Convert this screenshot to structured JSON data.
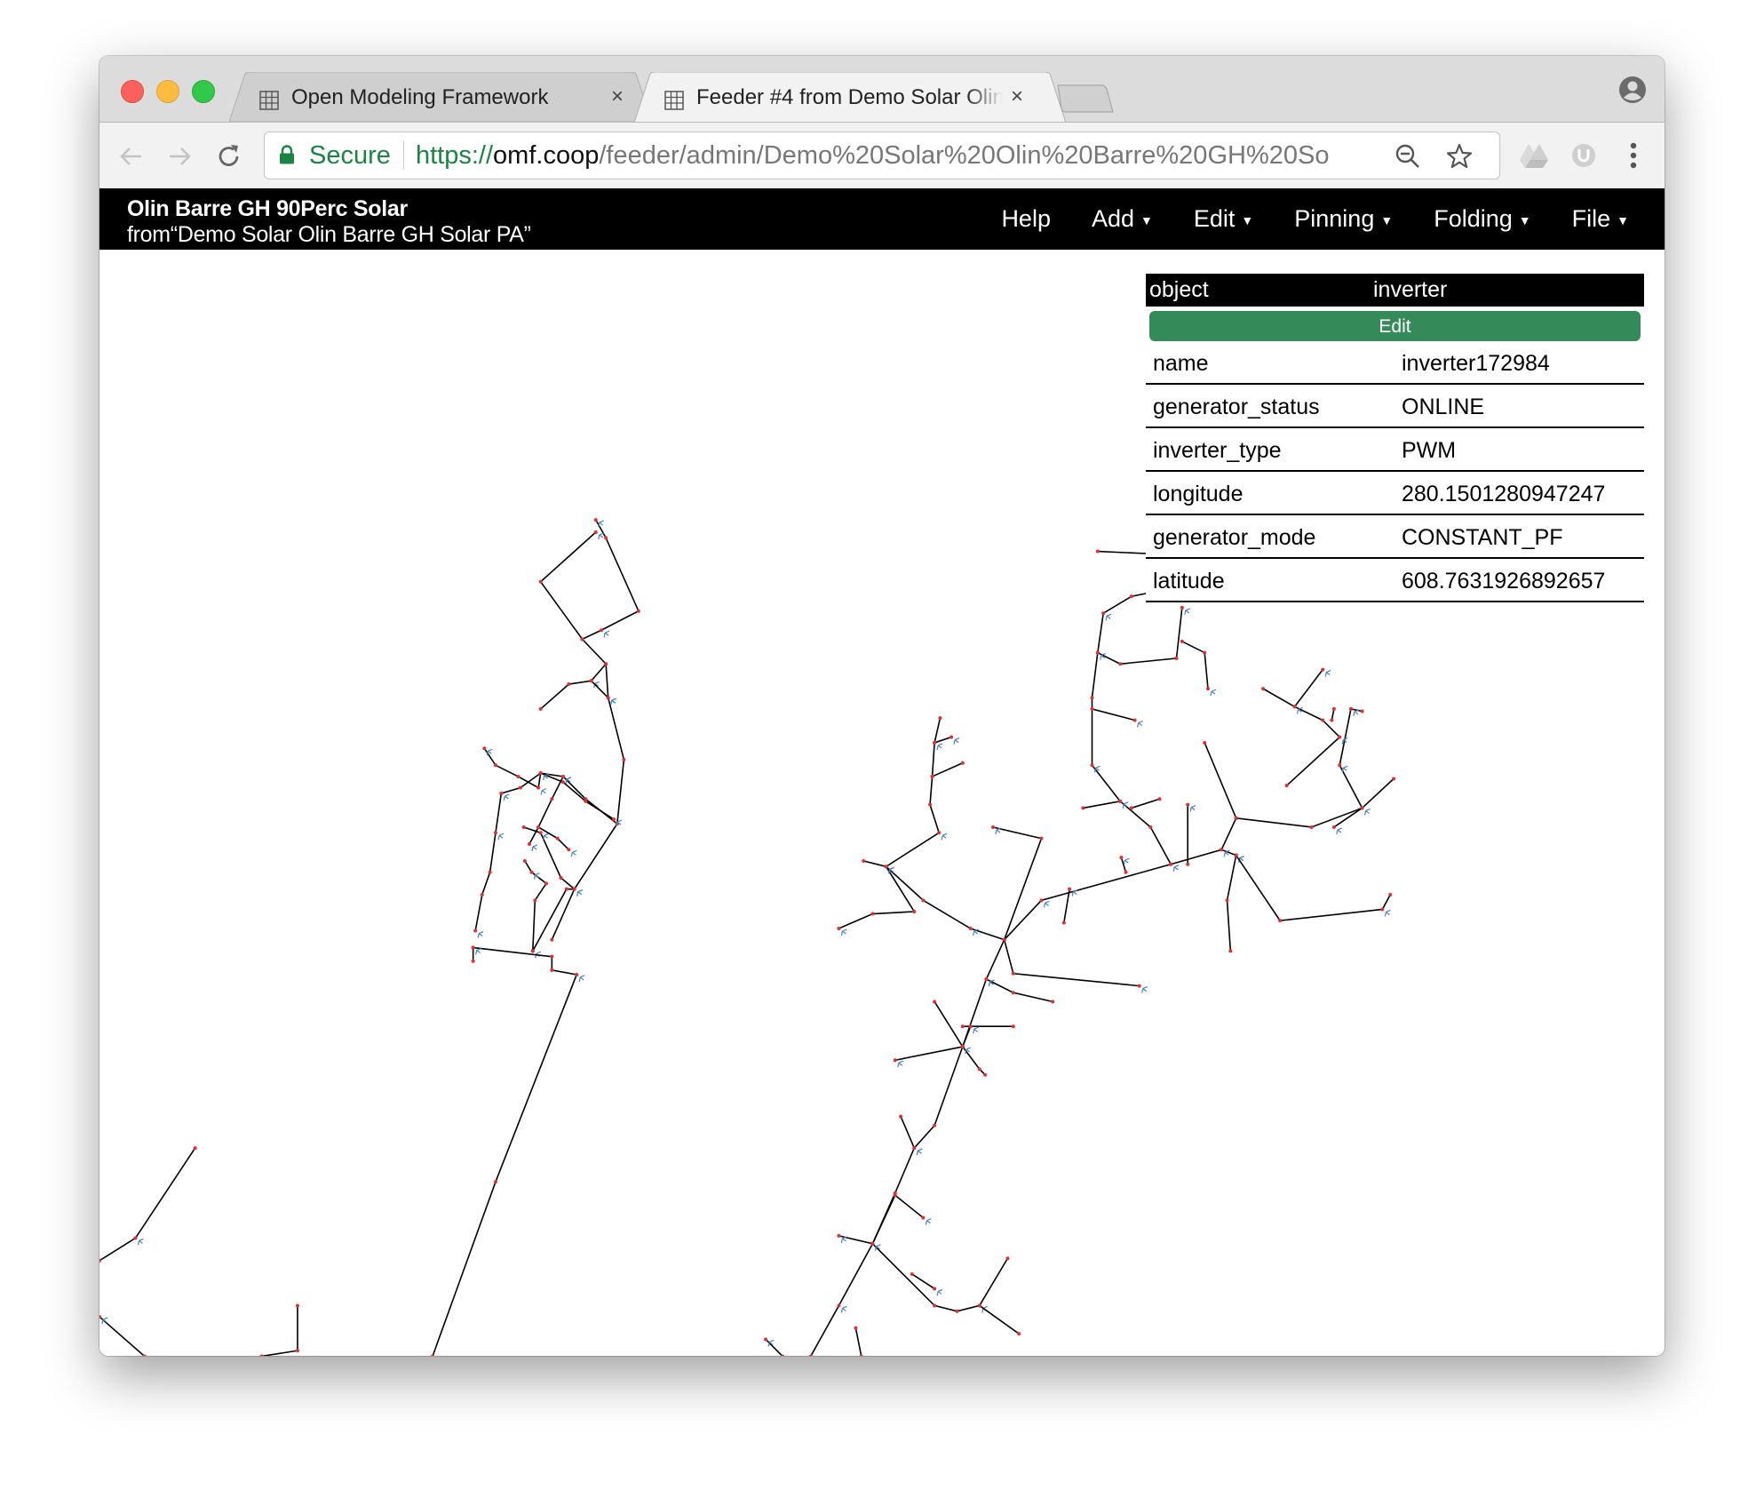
{
  "browser": {
    "tabs": [
      {
        "title": "Open Modeling Framework",
        "icon": "grid-page-icon",
        "close": "×",
        "active": false
      },
      {
        "title": "Feeder #4 from Demo Solar Olin",
        "icon": "grid-page-icon",
        "close": "×",
        "active": true
      }
    ],
    "secure_label": "Secure",
    "url": {
      "scheme": "https://",
      "host": "omf.coop",
      "path": "/feeder/admin/Demo%20Solar%20Olin%20Barre%20GH%20Solar%..."
    },
    "icons": [
      "back-icon",
      "forward-icon",
      "reload-icon",
      "lock-icon",
      "zoom-out-icon",
      "bookmark-star-icon",
      "google-drive-icon",
      "extension-u-icon",
      "menu-dots-icon",
      "profile-icon"
    ]
  },
  "app": {
    "title": "Olin Barre GH 90Perc Solar",
    "subtitle": "from“Demo Solar Olin Barre GH Solar PA”",
    "menu": [
      {
        "label": "Help",
        "dropdown": false
      },
      {
        "label": "Add",
        "dropdown": true
      },
      {
        "label": "Edit",
        "dropdown": true
      },
      {
        "label": "Pinning",
        "dropdown": true
      },
      {
        "label": "Folding",
        "dropdown": true
      },
      {
        "label": "File",
        "dropdown": true
      }
    ],
    "caret": "▼"
  },
  "panel": {
    "header_key": "object",
    "header_value": "inverter",
    "edit_label": "Edit",
    "edit_color": "#358a5a",
    "rows": [
      {
        "key": "name",
        "value": "inverter172984"
      },
      {
        "key": "generator_status",
        "value": "ONLINE"
      },
      {
        "key": "inverter_type",
        "value": "PWM"
      },
      {
        "key": "longitude",
        "value": "280.1501280947247"
      },
      {
        "key": "generator_mode",
        "value": "CONSTANT_PF"
      },
      {
        "key": "latitude",
        "value": "608.7631926892657"
      }
    ]
  },
  "feeder_graph": {
    "line_color": "#000000",
    "node_color": "#e03030",
    "load_marker_color": "#4a7fc1"
  }
}
